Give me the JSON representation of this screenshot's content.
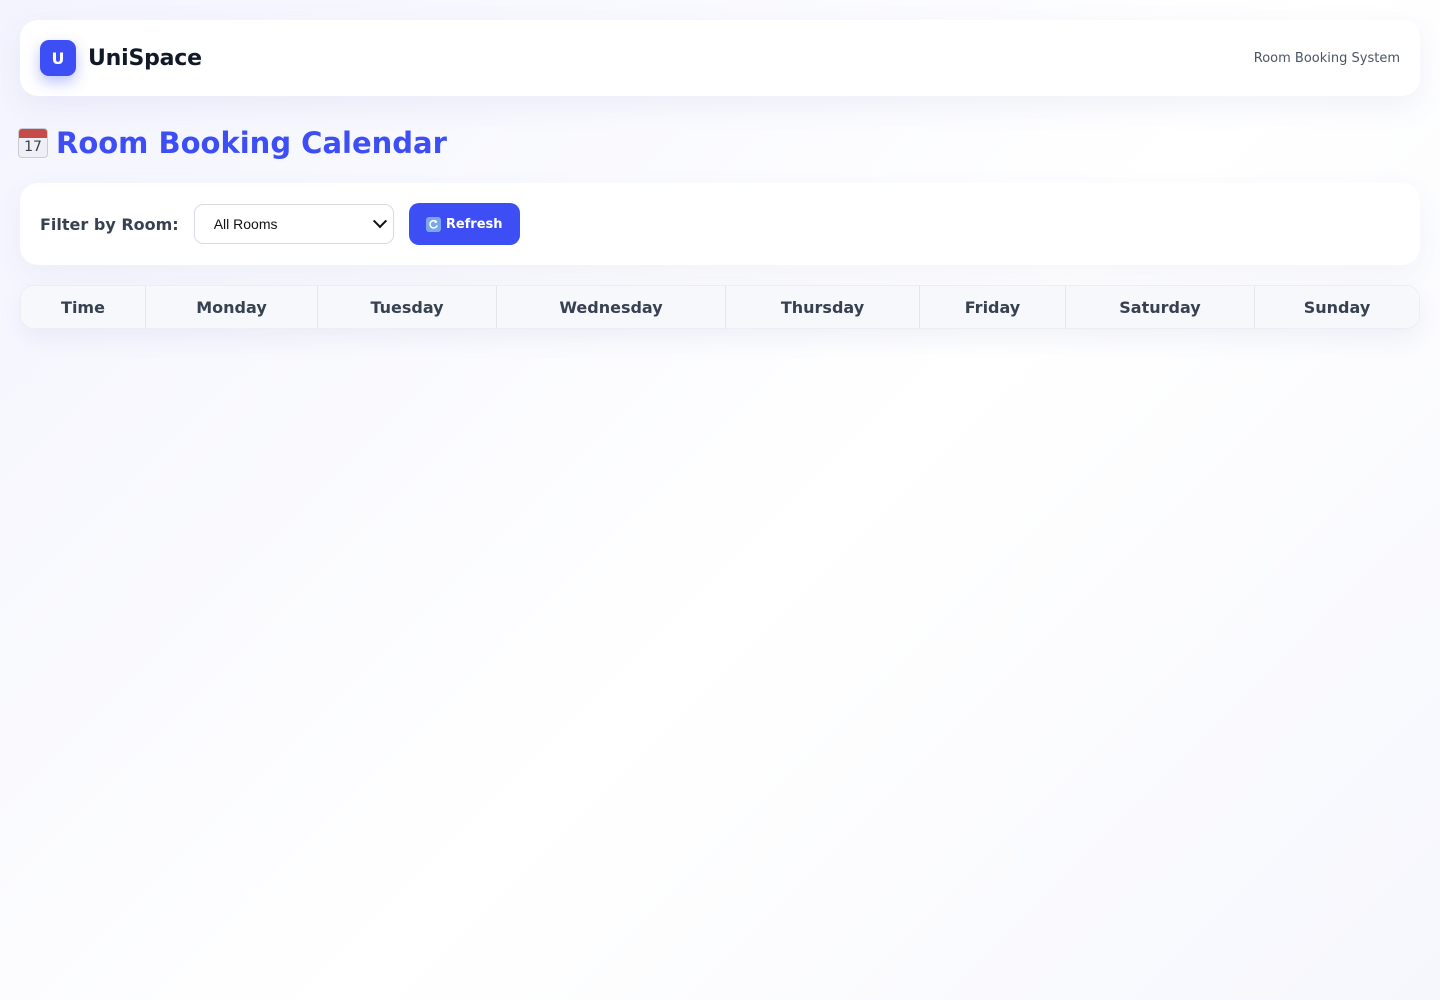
{
  "header": {
    "logo_letter": "U",
    "brand": "UniSpace",
    "subtitle": "Room Booking System"
  },
  "page": {
    "title_icon": "calendar-icon",
    "title_icon_day": "17",
    "title": "Room Booking Calendar"
  },
  "filter": {
    "label": "Filter by Room:",
    "selected_room": "All Rooms",
    "refresh_label": "Refresh",
    "refresh_icon": "refresh-icon"
  },
  "calendar": {
    "columns": [
      "Time",
      "Monday",
      "Tuesday",
      "Wednesday",
      "Thursday",
      "Friday",
      "Saturday",
      "Sunday"
    ]
  },
  "colors": {
    "accent": "#3d4ef5",
    "text": "#374151",
    "header_bg": "#f7f8fb"
  }
}
